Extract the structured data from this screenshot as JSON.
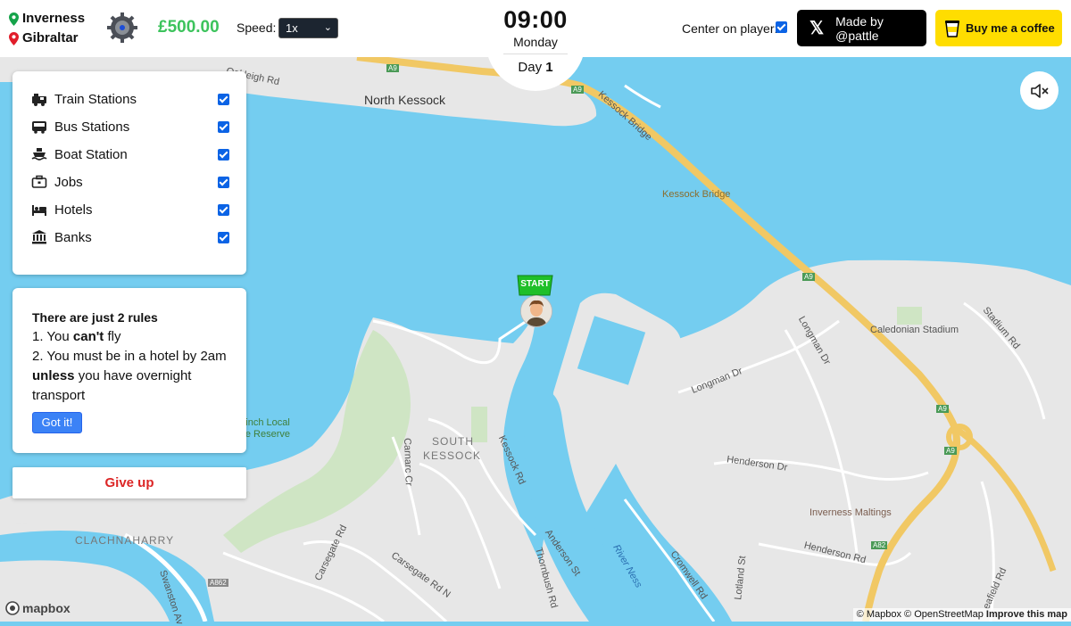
{
  "route": {
    "from": "Inverness",
    "to": "Gibraltar"
  },
  "money": "£500.00",
  "speed": {
    "label": "Speed:",
    "value": "1x"
  },
  "clock": {
    "time": "09:00",
    "weekday": "Monday",
    "day_label": "Day",
    "day_number": "1"
  },
  "center_player": {
    "label": "Center on player:",
    "checked": true
  },
  "credits": {
    "x_label": "Made by @pattle",
    "coffee_label": "Buy me a coffee"
  },
  "layers": [
    {
      "label": "Train Stations",
      "icon": "train-icon",
      "checked": true
    },
    {
      "label": "Bus Stations",
      "icon": "bus-icon",
      "checked": true
    },
    {
      "label": "Boat Station",
      "icon": "boat-icon",
      "checked": true
    },
    {
      "label": "Jobs",
      "icon": "briefcase-icon",
      "checked": true
    },
    {
      "label": "Hotels",
      "icon": "bed-icon",
      "checked": true
    },
    {
      "label": "Banks",
      "icon": "bank-icon",
      "checked": true
    }
  ],
  "rules": {
    "title": "There are just 2 rules",
    "rule1_pre": "1. You ",
    "rule1_bold": "can't",
    "rule1_post": " fly",
    "rule2_line": "2. You must be in a hotel by 2am",
    "rule2_bold": "unless",
    "rule2_post": " you have overnight transport",
    "button": "Got it!"
  },
  "give_up": "Give up",
  "start_flag": "START",
  "map_labels": {
    "oakleigh": "Oakleigh Rd",
    "north_kessock": "North Kessock",
    "kessock_bridge_road": "Kessock Bridge",
    "kessock_bridge_poi": "Kessock Bridge",
    "a9_1": "A9",
    "a9_2": "A9",
    "a9_3": "A9",
    "a9_4": "A9",
    "a9_5": "A9",
    "a82": "A82",
    "a862": "A862",
    "caledonian": "Caledonian Stadium",
    "stadium_rd": "Stadium Rd",
    "longman_dr": "Longman Dr",
    "longman_dr2": "Longman Dr",
    "merkinch_1": "erkinch Local",
    "merkinch_2": "ture Reserve",
    "south_1": "SOUTH",
    "south_2": "KESSOCK",
    "carnarc": "Carnarc Cr",
    "kessock_rd": "Kessock Rd",
    "henderson_dr": "Henderson Dr",
    "henderson_rd": "Henderson Rd",
    "inverness_maltings": "Inverness Maltings",
    "clachnaharry": "CLACHNAHARRY",
    "carsegate_rd": "Carsegate Rd",
    "carsegate_rd_n": "Carsegate Rd N",
    "thornbush": "Thornbush Rd",
    "anderson": "Anderson St",
    "river_ness": "River Ness",
    "cromwell": "Cromwell Rd",
    "lotland": "Lotland St",
    "seafield": "eafield Rd",
    "swanston": "Swanston Av"
  },
  "mapbox_logo": "mapbox",
  "attribution": {
    "mapbox": "© Mapbox",
    "osm": "© OpenStreetMap",
    "improve": "Improve this map"
  }
}
